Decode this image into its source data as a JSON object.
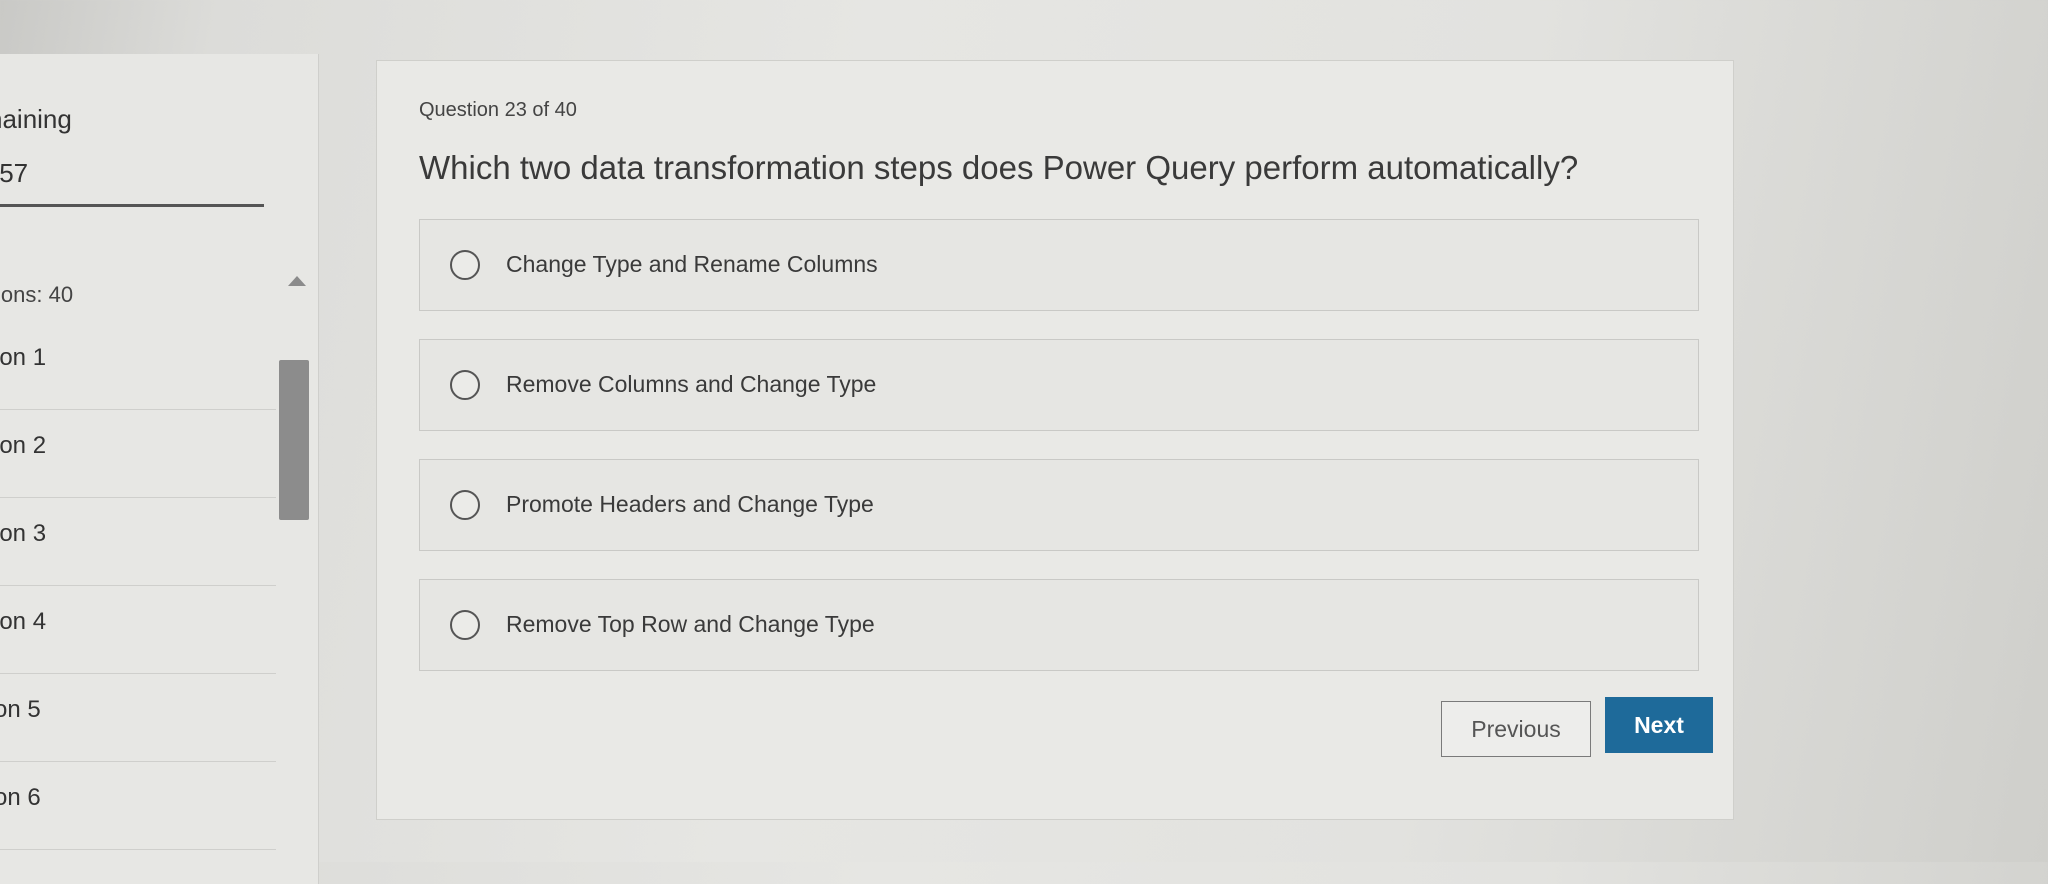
{
  "sidebar": {
    "remaining_label": "naining",
    "time_remaining": ":57",
    "question_count": "ions: 40",
    "items": [
      {
        "label": "ion 1"
      },
      {
        "label": "ion 2"
      },
      {
        "label": "ion 3"
      },
      {
        "label": "ion 4"
      },
      {
        "label": "on 5"
      },
      {
        "label": "on 6"
      }
    ]
  },
  "question": {
    "number_text": "Question 23 of 40",
    "text": "Which two data transformation steps does Power Query perform automatically?",
    "options": [
      {
        "label": "Change Type and Rename Columns",
        "selected": false
      },
      {
        "label": "Remove Columns and Change Type",
        "selected": false
      },
      {
        "label": "Promote Headers and Change Type",
        "selected": false
      },
      {
        "label": "Remove Top Row and Change Type",
        "selected": false
      }
    ]
  },
  "nav": {
    "previous_label": "Previous",
    "next_label": "Next"
  },
  "colors": {
    "next_button": "#1e6a9a",
    "background": "#e6e6e3"
  }
}
